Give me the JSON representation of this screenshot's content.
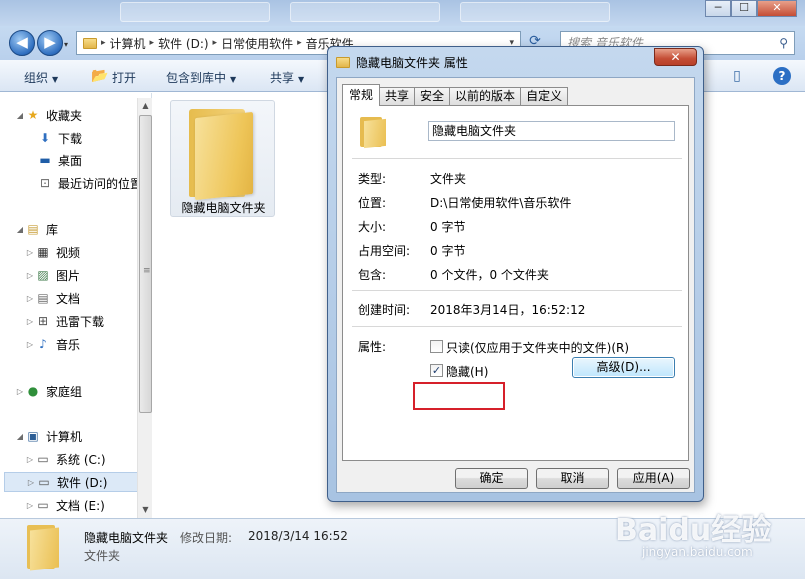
{
  "explorer": {
    "nav": {
      "back_glyph": "◀",
      "forward_glyph": "▶",
      "dropdown_glyph": "▾",
      "refresh_glyph": "⟳"
    },
    "address": {
      "crumbs": [
        "计算机",
        "软件 (D:)",
        "日常使用软件",
        "音乐软件"
      ],
      "separator": "▸",
      "dropdown_glyph": "▾"
    },
    "search": {
      "placeholder": "搜索 音乐软件",
      "icon_glyph": "⚲"
    },
    "window_buttons": {
      "minimize": "─",
      "maximize": "☐",
      "close": "✕"
    },
    "toolbar": {
      "organize": "组织",
      "open": "打开",
      "include_in_library": "包含到库中",
      "share": "共享",
      "dropdown_glyph": "▼",
      "open_icon_glyph": "📂",
      "layout_icon_glyph": "▯",
      "help": "?"
    },
    "sidebar": {
      "expander_open": "◢",
      "expander_closed": "▷",
      "favorites": "收藏夹",
      "favorites_items": [
        "下载",
        "桌面",
        "最近访问的位置"
      ],
      "libraries": "库",
      "libraries_items": [
        "视频",
        "图片",
        "文档",
        "迅雷下载",
        "音乐"
      ],
      "homegroup": "家庭组",
      "computer": "计算机",
      "computer_items": [
        "系统 (C:)",
        "软件 (D:)",
        "文档 (E:)"
      ],
      "icons": {
        "star": "★",
        "down": "⬇",
        "desktop": "▬",
        "recent": "⊡",
        "library": "▤",
        "video": "▦",
        "picture": "▨",
        "doc": "▤",
        "thunder": "⊞",
        "music": "♪",
        "homegroup": "●",
        "computer": "▣",
        "drive": "▭"
      },
      "scroll_up": "▲",
      "scroll_down": "▼",
      "grip": "≡"
    },
    "folder_tile": {
      "name": "隐藏电脑文件夹"
    },
    "details": {
      "name": "隐藏电脑文件夹",
      "modified_label": "修改日期:",
      "modified_value": "2018/3/14 16:52",
      "type": "文件夹"
    }
  },
  "dialog": {
    "title": "隐藏电脑文件夹 属性",
    "close": "✕",
    "tabs": [
      "常规",
      "共享",
      "安全",
      "以前的版本",
      "自定义"
    ],
    "folder_name": "隐藏电脑文件夹",
    "props": [
      {
        "label": "类型:",
        "value": "文件夹"
      },
      {
        "label": "位置:",
        "value": "D:\\日常使用软件\\音乐软件"
      },
      {
        "label": "大小:",
        "value": "0 字节"
      },
      {
        "label": "占用空间:",
        "value": "0 字节"
      },
      {
        "label": "包含:",
        "value": "0 个文件，0 个文件夹"
      }
    ],
    "created_label": "创建时间:",
    "created_value": "2018年3月14日，16:52:12",
    "attributes_label": "属性:",
    "readonly_label": "只读(仅应用于文件夹中的文件)(R)",
    "readonly_checked": false,
    "hidden_label": "隐藏(H)",
    "hidden_checked": true,
    "check_glyph": "✓",
    "advanced_button": "高级(D)...",
    "ok_button": "确定",
    "cancel_button": "取消",
    "apply_button": "应用(A)",
    "highlight_color": "#d6202a"
  },
  "watermark": {
    "brand": "Baidu经验",
    "url": "jingyan.baidu.com"
  }
}
